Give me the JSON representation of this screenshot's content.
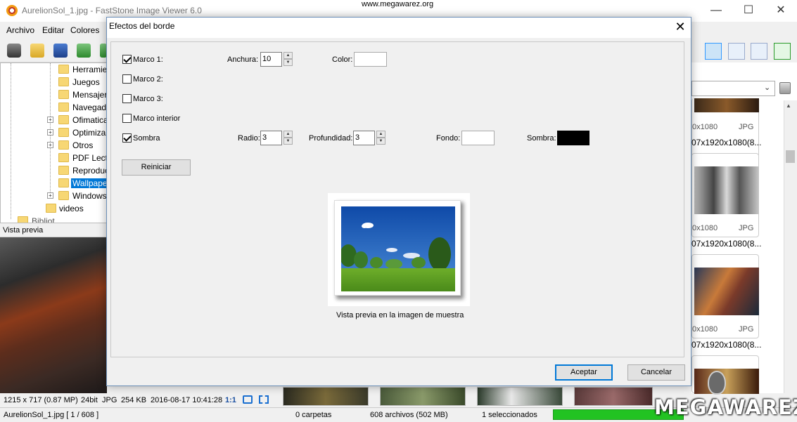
{
  "window": {
    "title": "AurelionSol_1.jpg - FastStone Image Viewer 6.0",
    "watermark": "www.megawarez.org",
    "controls": {
      "minimize": "—",
      "maximize": "☐",
      "close": "✕"
    }
  },
  "menu": [
    "Archivo",
    "Editar",
    "Colores"
  ],
  "tree": {
    "items": [
      {
        "label": "Herramie",
        "expandable": false
      },
      {
        "label": "Juegos",
        "expandable": false
      },
      {
        "label": "Mensajer",
        "expandable": false
      },
      {
        "label": "Navegado",
        "expandable": false
      },
      {
        "label": "Ofimatica",
        "expandable": true
      },
      {
        "label": "Optimiza",
        "expandable": true
      },
      {
        "label": "Otros",
        "expandable": true
      },
      {
        "label": "PDF Lecto",
        "expandable": false
      },
      {
        "label": "Reproduc",
        "expandable": false
      },
      {
        "label": "Wallpape",
        "expandable": false,
        "selected": true
      },
      {
        "label": "Windows",
        "expandable": true
      }
    ],
    "videos": "videos",
    "partial": "Bibliot"
  },
  "preview": {
    "label": "Vista previa"
  },
  "status1": {
    "dims": "1215 x 717 (0.87 MP)",
    "depth": "24bit",
    "format": "JPG",
    "size": "254 KB",
    "date": "2016-08-17 10:41:28",
    "zoom": "1:1"
  },
  "status2": {
    "file": "AurelionSol_1.jpg [ 1 / 608 ]",
    "folders": "0 carpetas",
    "files": "608 archivos (502 MB)",
    "selected": "1 seleccionados"
  },
  "thumbs": [
    {
      "dim": "0x1080",
      "type": "JPG",
      "name": "07x1920x1080(8..."
    },
    {
      "dim": "0x1080",
      "type": "JPG",
      "name": "07x1920x1080(8..."
    },
    {
      "dim": "0x1080",
      "type": "JPG",
      "name": "07x1920x1080(8..."
    }
  ],
  "logo": "MEGAWAREZ",
  "dialog": {
    "title": "Efectos del borde",
    "close": "✕",
    "rows": {
      "marco1": {
        "label": "Marco 1:",
        "checked": true
      },
      "marco2": {
        "label": "Marco 2:",
        "checked": false
      },
      "marco3": {
        "label": "Marco 3:",
        "checked": false
      },
      "interior": {
        "label": "Marco interior",
        "checked": false
      },
      "sombra": {
        "label": "Sombra",
        "checked": true
      }
    },
    "anchura": {
      "label": "Anchura:",
      "value": "10"
    },
    "color": {
      "label": "Color:",
      "swatch": "#ffffff"
    },
    "radio": {
      "label": "Radio:",
      "value": "3"
    },
    "profundidad": {
      "label": "Profundidad:",
      "value": "3"
    },
    "fondo": {
      "label": "Fondo:",
      "swatch": "#ffffff"
    },
    "sombra_color": {
      "label": "Sombra:",
      "swatch": "#000000"
    },
    "reset": "Reiniciar",
    "caption": "Vista previa en la imagen de muestra",
    "accept": "Aceptar",
    "cancel": "Cancelar"
  }
}
